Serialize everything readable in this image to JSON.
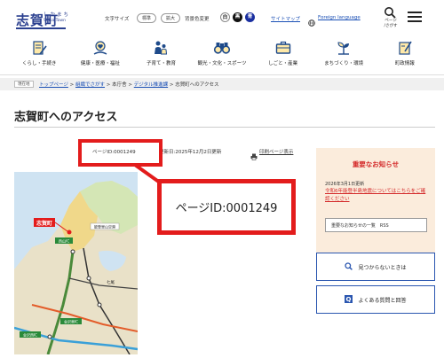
{
  "header": {
    "logo_kanji": "志賀町",
    "logo_kana": "しかまち",
    "logo_roman": "Shika Town",
    "text_size_label": "文字サイズ",
    "text_size_standard": "標準",
    "text_size_large": "拡大",
    "bg_color_label": "背景色変更",
    "bg_white": "白",
    "bg_black": "黒",
    "bg_blue": "青",
    "sitemap": "サイトマップ",
    "foreign_language": "Foreign language",
    "search_caption": "ページ\n/さがす",
    "colors": {
      "brand": "#2a3f8f",
      "accent_red": "#e31c1c"
    }
  },
  "nav": {
    "items": [
      {
        "label": "くらし・手続き",
        "icon": "document-pen-icon"
      },
      {
        "label": "健康・医療・福祉",
        "icon": "heart-hand-icon"
      },
      {
        "label": "子育て・教育",
        "icon": "family-icon"
      },
      {
        "label": "観光・文化・スポーツ",
        "icon": "binoculars-icon"
      },
      {
        "label": "しごと・産業",
        "icon": "briefcase-icon"
      },
      {
        "label": "まちづくり・環境",
        "icon": "sprout-icon"
      },
      {
        "label": "町政情報",
        "icon": "notebook-pen-icon"
      }
    ]
  },
  "breadcrumb": {
    "tag": "現在地",
    "items": [
      "トップページ",
      "組織でさがす",
      "本庁舎",
      "デジタル推進課",
      "志賀町へのアクセス"
    ],
    "separator": ">"
  },
  "page": {
    "title": "志賀町へのアクセス",
    "page_id_label": "ページID:0001249",
    "updated": "更新日:2025年12月2日更新",
    "print": "印刷ページ表示",
    "page_id_zoom": "ページID:0001249"
  },
  "map": {
    "place_label": "志賀町",
    "labels": [
      "西山IC",
      "能登里山空港",
      "七尾",
      "金沢東IC",
      "金沢西IC"
    ]
  },
  "notice": {
    "title": "重要なお知らせ",
    "date": "2026年3月1日更新",
    "link": "令和6年能登半島地震についてはこちらをご確認ください",
    "list_button": "重要なお知らせの一覧　RSS"
  },
  "side": {
    "not_found": "見つからないときは",
    "faq": "よくある質問と回答"
  }
}
